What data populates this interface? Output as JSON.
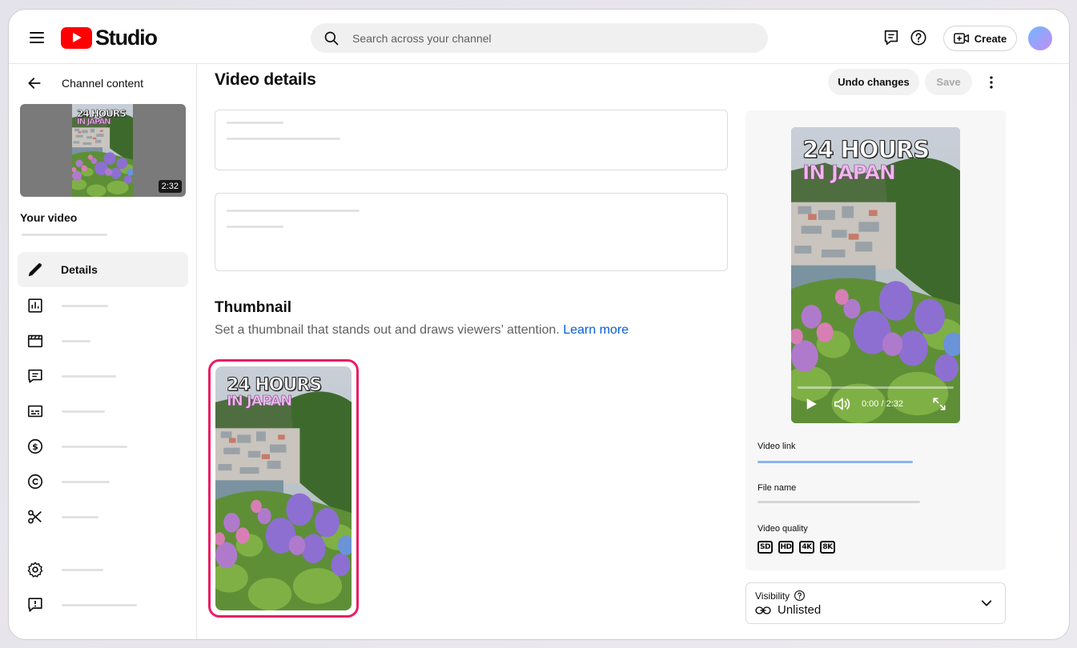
{
  "app": {
    "title": "Studio",
    "colors": {
      "brand": "#ff0000",
      "accent": "#065fd4",
      "highlight": "#e91e63"
    }
  },
  "header": {
    "search_placeholder": "Search across your channel",
    "icons": [
      "menu-icon",
      "search-icon",
      "feedback-icon",
      "help-icon",
      "create-video-icon"
    ],
    "create_label": "Create"
  },
  "sidebar": {
    "back_label": "Channel content",
    "thumbnail_duration": "2:32",
    "thumbnail_title_line1": "24 HOURS",
    "thumbnail_title_line2": "IN JAPAN",
    "your_video_label": "Your video",
    "items": [
      {
        "label": "Details",
        "icon": "pencil-icon",
        "active": true
      },
      {
        "label": "",
        "icon": "analytics-icon"
      },
      {
        "label": "",
        "icon": "editor-icon"
      },
      {
        "label": "",
        "icon": "comments-icon"
      },
      {
        "label": "",
        "icon": "subtitles-icon"
      },
      {
        "label": "",
        "icon": "monetization-icon"
      },
      {
        "label": "",
        "icon": "copyright-icon"
      },
      {
        "label": "",
        "icon": "clips-icon"
      },
      {
        "label": "",
        "icon": "settings-icon"
      },
      {
        "label": "",
        "icon": "send-feedback-icon"
      }
    ]
  },
  "main": {
    "title": "Video details",
    "undo_label": "Undo changes",
    "save_label": "Save",
    "thumbnail_section": {
      "heading": "Thumbnail",
      "description": "Set a thumbnail that stands out and draws viewers’ attention.",
      "learn_more": "Learn more",
      "title_line1": "24 HOURS",
      "title_line2": "IN JAPAN"
    }
  },
  "preview": {
    "title_line1": "24 HOURS",
    "title_line2": "IN JAPAN",
    "time": "0:00 / 2:32",
    "progress": 0,
    "video_link_label": "Video link",
    "file_name_label": "File name",
    "video_quality_label": "Video quality",
    "qualities": [
      "SD",
      "HD",
      "4K",
      "8K"
    ]
  },
  "visibility": {
    "label": "Visibility",
    "value": "Unlisted"
  }
}
